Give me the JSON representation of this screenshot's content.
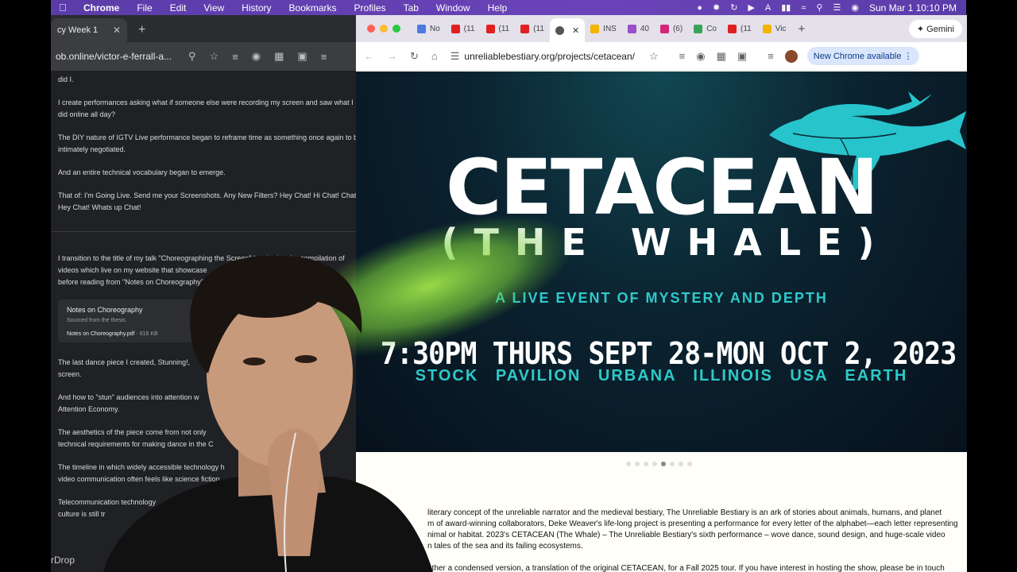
{
  "menubar": {
    "app": "Chrome",
    "items": [
      "File",
      "Edit",
      "View",
      "History",
      "Bookmarks",
      "Profiles",
      "Tab",
      "Window",
      "Help"
    ],
    "clock": "Sun Mar 1  10:10 PM"
  },
  "left_window": {
    "tab_title": "cy Week 1",
    "url": "ob.online/victor-e-ferrall-a...",
    "paragraphs": [
      "did I.",
      "I create performances asking what if someone else were recording my screen and saw what I",
      "did online all day?",
      "The DIY nature of IGTV Live performance began to reframe time as something once again to b",
      "intimately negotiated.",
      "And an entire technical vocabulary began to emerge.",
      "That of: I'm Going Live. Send me your Screenshots. Any New Filters? Hey Chat! Hi Chat! Chat!",
      "Hey Chat! Whats up Chat!",
      "I transition to the title of my talk \"Choreographing the Screen\" by sharing the compilation of",
      "videos which live on my website that showcase",
      "before reading from \"Notes on Choreography\"",
      "The last dance piece I created, Stunning!,",
      "screen.",
      "And how to \"stun\" audiences into attention w",
      "Attention Economy.",
      "The aesthetics of the piece come from not only",
      "technical requirements for making dance in the C",
      "The timeline in which widely accessible technology h",
      "video communication often feels like science fiction.",
      "Telecommunication technology",
      "culture is still tr"
    ],
    "file_card": {
      "title": "Notes on Choreography",
      "subtitle": "Sourced from the thesis",
      "filename": "Notes on Choreography.pdf",
      "size": "616 KB"
    },
    "airdrop": "rDrop"
  },
  "right_window": {
    "tabs": [
      {
        "label": "No",
        "color": "#4a7be0"
      },
      {
        "label": "(11",
        "color": "#e02020"
      },
      {
        "label": "(11",
        "color": "#e02020"
      },
      {
        "label": "(11",
        "color": "#e02020"
      },
      {
        "label": "",
        "color": "#555555",
        "active": true
      },
      {
        "label": "INS",
        "color": "#f4b400"
      },
      {
        "label": "40",
        "color": "#9b4ec9"
      },
      {
        "label": "(6)",
        "color": "#d6247b"
      },
      {
        "label": "Co",
        "color": "#3aa35a"
      },
      {
        "label": "(11",
        "color": "#e02020"
      },
      {
        "label": "Vic",
        "color": "#f4b400"
      }
    ],
    "gemini_label": "Gemini",
    "url": "unreliablebestiary.org/projects/cetacean/",
    "update_label": "New Chrome available",
    "hero": {
      "title": "CETACEAN",
      "subtitle": "(THE WHALE)",
      "tagline": "A LIVE EVENT OF MYSTERY AND DEPTH",
      "date": "7:30PM  THURS SEPT 28-MON OCT 2, 2023",
      "location": "STOCK PAVILION  URBANA  ILLINOIS  USA  EARTH"
    },
    "carousel": {
      "total": 8,
      "active_index": 4
    },
    "article": {
      "line1": "literary concept of the unreliable narrator and the medieval bestiary, The Unreliable Bestiary is an ark of stories about animals, humans, and planet",
      "line2": "m of award-winning collaborators, Deke Weaver's life-long project is presenting a performance for every letter of the alphabet—each letter representing",
      "line3": "nimal or habitat. 2023's CETACEAN (The Whale) – The Unreliable Bestiary's sixth performance – wove dance, sound design, and huge-scale video",
      "line4": "n tales of the sea and its failing ecosystems.",
      "line5": "ather a condensed version, a translation of the original CETACEAN, for a Fall 2025 tour. If you have interest in hosting the show, please be in touch"
    }
  },
  "colors": {
    "hero_accent": "#2fc9c9",
    "menubar": "#5a3ca8"
  }
}
